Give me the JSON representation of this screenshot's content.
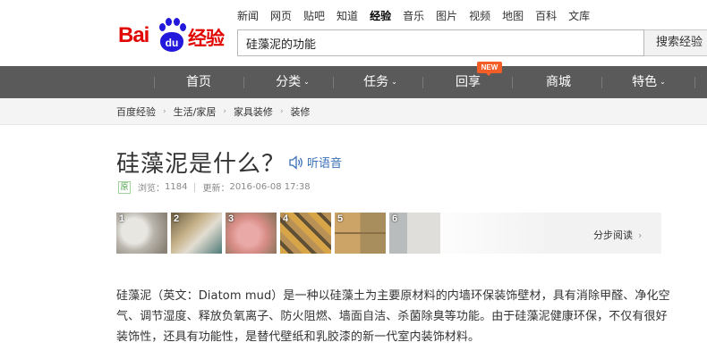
{
  "logo": {
    "bai": "Bai",
    "du": "du",
    "jingyan": "经验"
  },
  "topnav": [
    {
      "label": "新闻",
      "active": false
    },
    {
      "label": "网页",
      "active": false
    },
    {
      "label": "贴吧",
      "active": false
    },
    {
      "label": "知道",
      "active": false
    },
    {
      "label": "经验",
      "active": true
    },
    {
      "label": "音乐",
      "active": false
    },
    {
      "label": "图片",
      "active": false
    },
    {
      "label": "视频",
      "active": false
    },
    {
      "label": "地图",
      "active": false
    },
    {
      "label": "百科",
      "active": false
    },
    {
      "label": "文库",
      "active": false
    }
  ],
  "search": {
    "value": "硅藻泥的功能",
    "button": "搜索经验"
  },
  "mainnav": {
    "home": "首页",
    "category": "分类",
    "task": "任务",
    "share": "回享",
    "share_badge": "NEW",
    "mall": "商城",
    "featured": "特色"
  },
  "breadcrumb": [
    "百度经验",
    "生活/家居",
    "家具装修",
    "装修"
  ],
  "article": {
    "title": "硅藻泥是什么？",
    "listen": "听语音",
    "original_badge": "原",
    "views_label": "浏览：",
    "views": "1184",
    "updated_label": "更新：",
    "updated": "2016-06-08 17:38",
    "steps": [
      "1",
      "2",
      "3",
      "4",
      "5",
      "6"
    ],
    "step_read": "分步阅读",
    "paragraph": "硅藻泥（英文：Diatom mud）是一种以硅藻土为主要原材料的内墙环保装饰壁材，具有消除甲醛、净化空气、调节湿度、释放负氧离子、防火阻燃、墙面自洁、杀菌除臭等功能。由于硅藻泥健康环保，不仅有很好装饰性，还具有功能性，是替代壁纸和乳胶漆的新一代室内装饰材料。"
  },
  "colors": {
    "brand_red": "#e10601",
    "brand_blue": "#2319dc",
    "nav_bg": "#5a5a5a",
    "link_blue": "#3970b8",
    "badge_orange": "#f35d28"
  },
  "icons": {
    "listen": "speaker-icon",
    "step_read": "chevron-right-icon"
  }
}
